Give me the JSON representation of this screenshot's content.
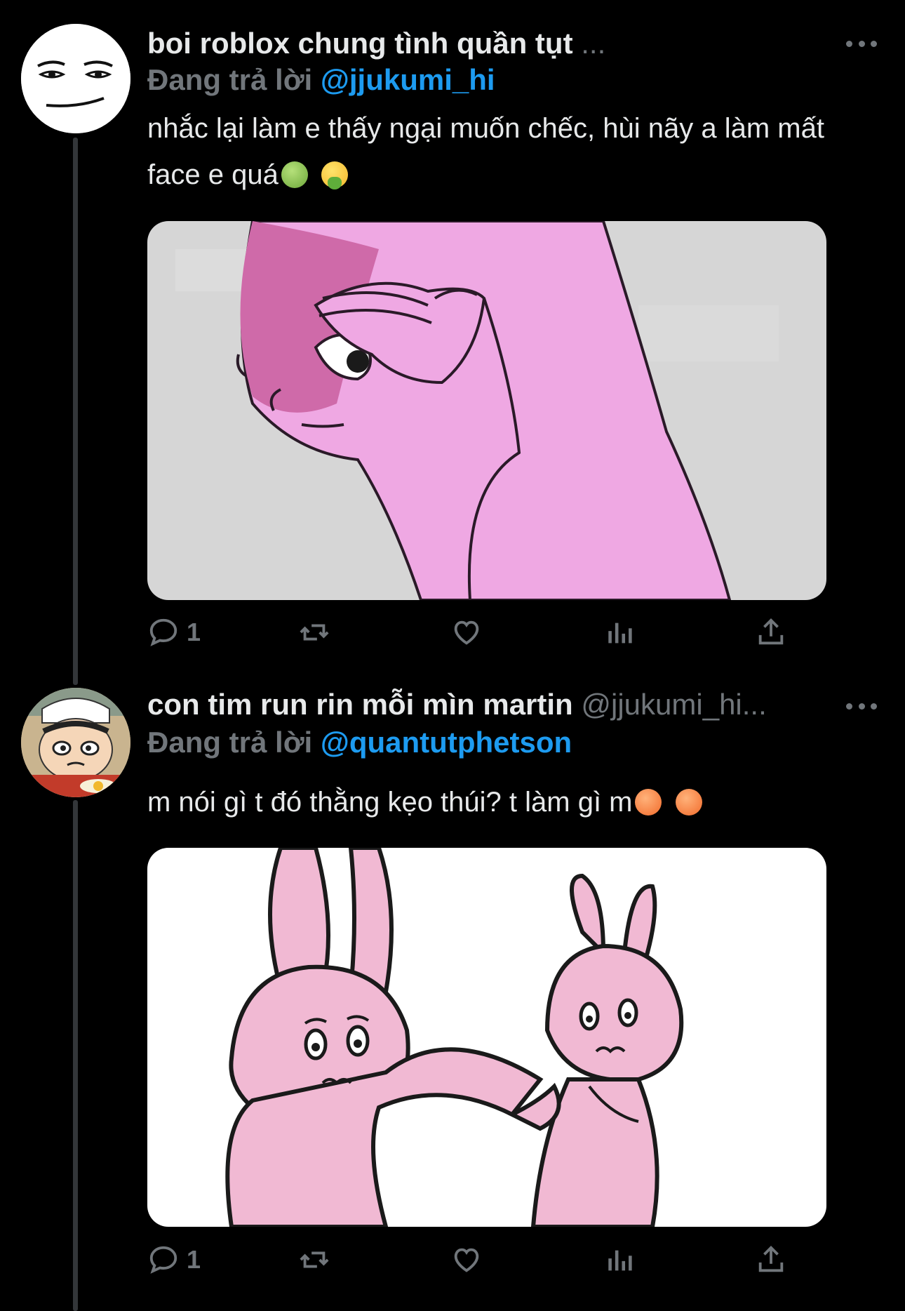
{
  "tweets": [
    {
      "display_name": "boi roblox chung tình quần tụt",
      "handle": "...",
      "replying_label": "Đang trả lời",
      "replying_to": "@jjukumi_hi",
      "text": "nhắc lại làm e thấy ngại muốn chếc, hùi nãy a làm mất face e quá",
      "emojis": [
        "nauseated-face",
        "vomiting-face"
      ],
      "reply_count": "1",
      "media_description": "pink cartoon figure covering eye with hand"
    },
    {
      "display_name": "con tim run rin mỗi mìn martin",
      "handle": "@jjukumi_hi...",
      "replying_label": "Đang trả lời",
      "replying_to": "@quantutphetson",
      "text": "m nói gì t đó thằng kẹo thúi? t làm gì m",
      "emojis": [
        "angry-face",
        "angry-face"
      ],
      "reply_count": "1",
      "media_description": "two pink cartoon rabbits, one grabbing the other"
    }
  ],
  "colors": {
    "background": "#000000",
    "text": "#e7e9ea",
    "muted": "#71767b",
    "link": "#1d9bf0"
  }
}
